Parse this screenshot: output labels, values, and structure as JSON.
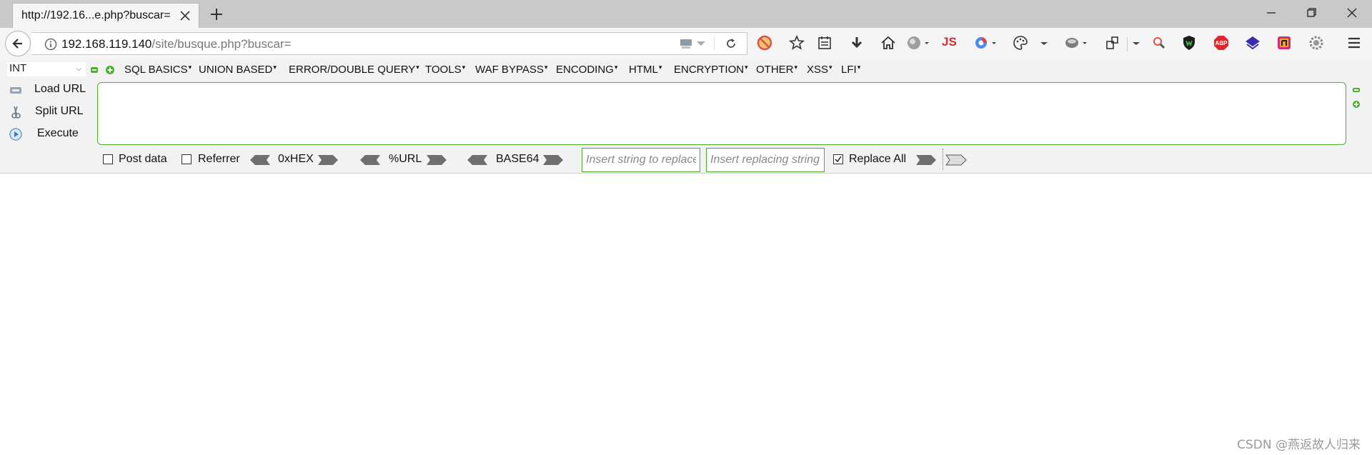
{
  "tab": {
    "title": "http://192.16...e.php?buscar="
  },
  "address": {
    "host": "192.168.119.140",
    "path": "/site/busque.php?buscar="
  },
  "toolbar": {
    "js_label": "JS",
    "abp_label": "ABP"
  },
  "hackbar": {
    "int_value": "INT",
    "menu": [
      "SQL BASICS",
      "UNION BASED",
      "ERROR/DOUBLE QUERY",
      "TOOLS",
      "WAF BYPASS",
      "ENCODING",
      "HTML",
      "ENCRYPTION",
      "OTHER",
      "XSS",
      "LFI"
    ],
    "load_url": "Load URL",
    "split_url": "Split URL",
    "execute": "Execute",
    "post_data": "Post data",
    "referrer": "Referrer",
    "hex": "0xHEX",
    "url_enc": "%URL",
    "base64": "BASE64",
    "replace_placeholder": "Insert string to replace",
    "replacing_placeholder": "Insert replacing string",
    "replace_all": "Replace All",
    "post_data_checked": false,
    "referrer_checked": false,
    "replace_all_checked": true
  },
  "watermark": "CSDN @燕返故人归来"
}
